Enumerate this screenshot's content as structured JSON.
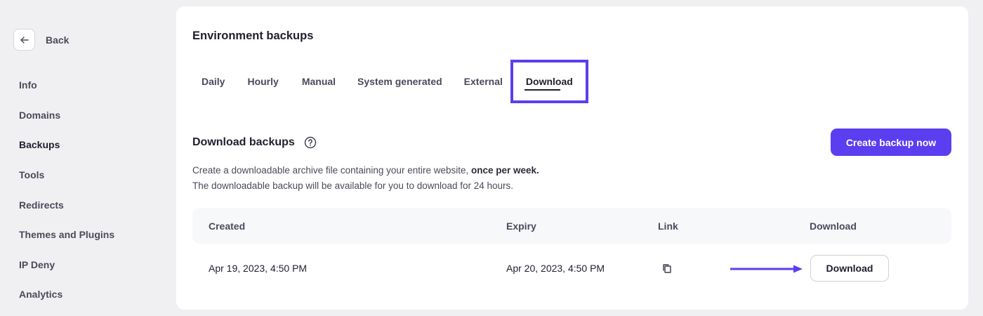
{
  "sidebar": {
    "back_label": "Back",
    "items": [
      {
        "label": "Info"
      },
      {
        "label": "Domains"
      },
      {
        "label": "Backups"
      },
      {
        "label": "Tools"
      },
      {
        "label": "Redirects"
      },
      {
        "label": "Themes and Plugins"
      },
      {
        "label": "IP Deny"
      },
      {
        "label": "Analytics"
      }
    ],
    "active": "Backups"
  },
  "main": {
    "title": "Environment backups",
    "tabs": [
      {
        "label": "Daily"
      },
      {
        "label": "Hourly"
      },
      {
        "label": "Manual"
      },
      {
        "label": "System generated"
      },
      {
        "label": "External"
      },
      {
        "label": "Download"
      }
    ],
    "active_tab": "Download",
    "section_title": "Download backups",
    "create_button": "Create backup now",
    "description": {
      "line1_prefix": "Create a downloadable archive file containing your entire website, ",
      "line1_bold": "once per week.",
      "line2": "The downloadable backup will be available for you to download for 24 hours."
    },
    "table": {
      "headers": {
        "created": "Created",
        "expiry": "Expiry",
        "link": "Link",
        "download": "Download"
      },
      "rows": [
        {
          "created": "Apr 19, 2023, 4:50 PM",
          "expiry": "Apr 20, 2023, 4:50 PM",
          "download_label": "Download"
        }
      ]
    }
  },
  "colors": {
    "accent": "#5b3ef0",
    "text": "#1f1f2e",
    "muted": "#4a4a5a",
    "background": "#f0f0f3",
    "card": "#ffffff"
  },
  "icons": {
    "back": "arrow-left-icon",
    "help": "question-circle-icon",
    "copy": "copy-icon",
    "annotation": "arrow-right-icon"
  }
}
